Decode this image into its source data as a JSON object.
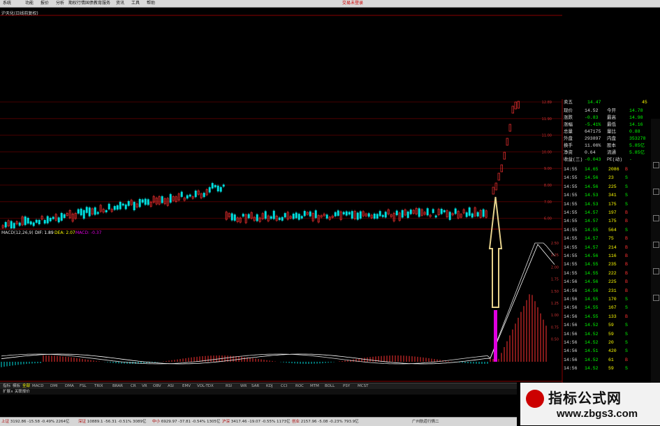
{
  "menu": {
    "items": [
      "系统",
      "功能",
      "报价",
      "分析",
      "期权行情",
      "国债教育服务",
      "资讯",
      "工具",
      "帮助"
    ],
    "right_text": "交易未登录"
  },
  "chart_title": "沪天化(日线前复权)",
  "macd_label": "MACD",
  "macd_params": "(12,26,9)",
  "macd_dif": "DIF: 1.89",
  "macd_dea": "DEA: 2.07",
  "macd_val": "MACD: -0.37",
  "price_axis": [
    "12.89",
    "11.90",
    "11.00",
    "10.00",
    "9.00",
    "8.00",
    "7.00",
    "6.00"
  ],
  "macd_axis": [
    "2.50",
    "2.25",
    "2.00",
    "1.75",
    "1.50",
    "1.25",
    "1.00",
    "0.75",
    "0.50"
  ],
  "date_axis": [
    "2016年",
    "3",
    "4",
    "5",
    "6",
    "7",
    "8",
    "9",
    "10",
    "11"
  ],
  "quote": {
    "sell5": {
      "label": "卖五",
      "price": "14.47",
      "vol": "45"
    },
    "rows": [
      {
        "l1": "现价",
        "v1": "14.52",
        "l2": "今开",
        "v2": "14.78"
      },
      {
        "l1": "涨跌",
        "v1": "-0.83",
        "l2": "最高",
        "v2": "14.98"
      },
      {
        "l1": "涨幅",
        "v1": "-5.41%",
        "l2": "最低",
        "v2": "14.16"
      },
      {
        "l1": "总量",
        "v1": "647175",
        "l2": "量比",
        "v2": "0.88"
      },
      {
        "l1": "外盘",
        "v1": "293897",
        "l2": "内盘",
        "v2": "353278"
      },
      {
        "l1": "换手",
        "v1": "11.06%",
        "l2": "股本",
        "v2": "5.85亿"
      },
      {
        "l1": "净资",
        "v1": "0.64",
        "l2": "流通",
        "v2": "5.85亿"
      },
      {
        "l1": "收益(三)",
        "v1": "-0.043",
        "l2": "PE(动)",
        "v2": "-"
      }
    ],
    "ticks": [
      {
        "t": "14:55",
        "p": "14.65",
        "v": "2086",
        "d": "B"
      },
      {
        "t": "14:55",
        "p": "14.56",
        "v": "23",
        "d": "S"
      },
      {
        "t": "14:55",
        "p": "14.56",
        "v": "225",
        "d": "S"
      },
      {
        "t": "14:55",
        "p": "14.53",
        "v": "341",
        "d": "S"
      },
      {
        "t": "14:55",
        "p": "14.53",
        "v": "175",
        "d": "S"
      },
      {
        "t": "14:55",
        "p": "14.57",
        "v": "197",
        "d": "B"
      },
      {
        "t": "14:55",
        "p": "14.57",
        "v": "175",
        "d": "B"
      },
      {
        "t": "14:55",
        "p": "14.55",
        "v": "564",
        "d": "S"
      },
      {
        "t": "14:55",
        "p": "14.57",
        "v": "75",
        "d": "B"
      },
      {
        "t": "14:55",
        "p": "14.57",
        "v": "214",
        "d": "B"
      },
      {
        "t": "14:55",
        "p": "14.56",
        "v": "116",
        "d": "B"
      },
      {
        "t": "14:55",
        "p": "14.55",
        "v": "235",
        "d": "B"
      },
      {
        "t": "14:55",
        "p": "14.55",
        "v": "222",
        "d": "B"
      },
      {
        "t": "14:56",
        "p": "14.56",
        "v": "225",
        "d": "B"
      },
      {
        "t": "14:56",
        "p": "14.56",
        "v": "231",
        "d": "B"
      },
      {
        "t": "14:56",
        "p": "14.55",
        "v": "170",
        "d": "S"
      },
      {
        "t": "14:56",
        "p": "14.55",
        "v": "167",
        "d": "S"
      },
      {
        "t": "14:56",
        "p": "14.55",
        "v": "133",
        "d": "B"
      },
      {
        "t": "14:56",
        "p": "14.52",
        "v": "59",
        "d": "S"
      },
      {
        "t": "14:56",
        "p": "14.52",
        "v": "59",
        "d": "S"
      },
      {
        "t": "14:56",
        "p": "14.52",
        "v": "20",
        "d": "S"
      },
      {
        "t": "14:56",
        "p": "14.51",
        "v": "420",
        "d": "S"
      },
      {
        "t": "14:56",
        "p": "14.52",
        "v": "61",
        "d": "B"
      },
      {
        "t": "14:56",
        "p": "14.52",
        "v": "59",
        "d": "S"
      }
    ]
  },
  "tabs": [
    "指标",
    "模板",
    "全部",
    "MACD",
    "DMI",
    "DMA",
    "FSL",
    "TRIX",
    "BRAR",
    "CR",
    "VR",
    "OBV",
    "ASI",
    "EMV",
    "VOL-TDX",
    "RSI",
    "WR",
    "SAR",
    "KDJ",
    "CCI",
    "ROC",
    "MTM",
    "BOLL",
    "PSY",
    "MCST"
  ],
  "subbar_text": "扩展∧ 关联报价",
  "status": [
    {
      "label": "上证",
      "text": "3192.86  -15.58  -0.49%  2264亿"
    },
    {
      "label": "深证",
      "text": "10889.1  -56.31  -0.51%  3089亿"
    },
    {
      "label": "中小",
      "text": "6929.97  -37.81  -0.54%  1305亿"
    },
    {
      "label": "沪深",
      "text": "3417.46  -19.07  -0.55%  1173亿"
    },
    {
      "label": "创业",
      "text": "2157.96  -5.08  -0.23%  793.9亿"
    },
    {
      "label": "",
      "text": "广州航道行情二"
    }
  ],
  "watermark": {
    "line1": "指标公式网",
    "line2": "www.zbgs3.com"
  },
  "colors": {
    "up": "#ff3232",
    "down": "#00e0e0",
    "axis": "#a00000",
    "arrow": "#e6d28c",
    "stem": "#e000e0",
    "green": "#00e000"
  }
}
